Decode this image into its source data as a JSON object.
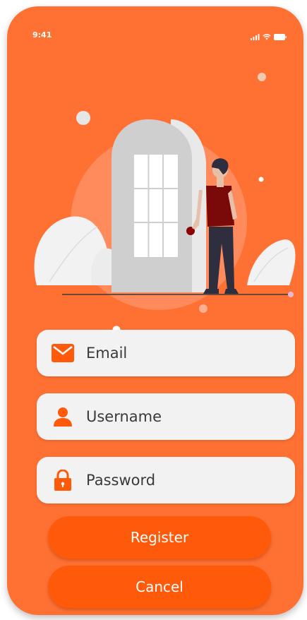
{
  "status_bar": {
    "time": "9:41",
    "signal_icon": "signal-bars-icon",
    "wifi_icon": "wifi-icon",
    "battery_icon": "battery-icon"
  },
  "illustration": {
    "description_icon": "person-opening-door-illustration"
  },
  "form": {
    "email": {
      "placeholder": "Email",
      "icon": "mail-icon"
    },
    "username": {
      "placeholder": "Username",
      "icon": "user-icon"
    },
    "password": {
      "placeholder": "Password",
      "icon": "lock-icon"
    }
  },
  "buttons": {
    "register": "Register",
    "cancel": "Cancel"
  },
  "colors": {
    "background": "#ff7133",
    "button": "#ff5a0a",
    "field": "#f2f2f2",
    "accent_icon": "#ff5a0a"
  }
}
